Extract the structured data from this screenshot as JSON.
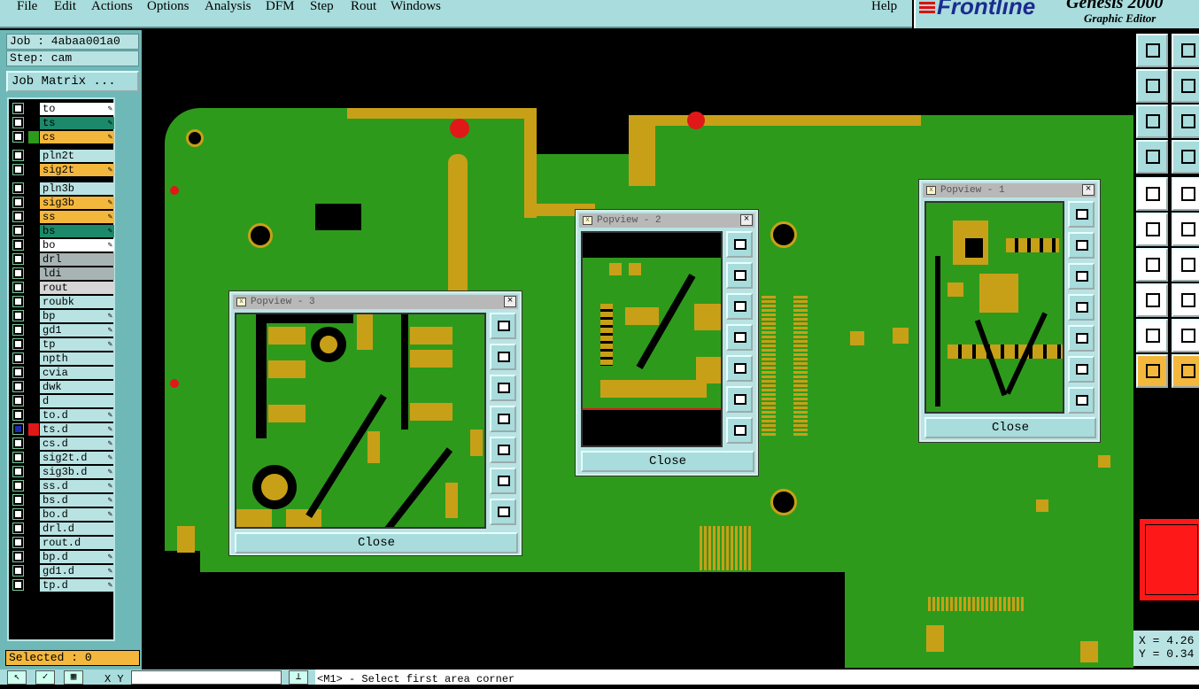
{
  "menu": {
    "items": [
      "File",
      "Edit",
      "Actions",
      "Options",
      "Analysis",
      "DFM",
      "Step",
      "Rout",
      "Windows"
    ],
    "help": "Help"
  },
  "brand": {
    "logo": "Frontline",
    "product": "Genesis 2000",
    "subtitle": "Graphic Editor"
  },
  "job": {
    "job_line": "Job : 4abaa001a0",
    "step_line": "Step: cam",
    "matrix_button": "Job Matrix ..."
  },
  "layers": [
    {
      "name": "to",
      "color": "#ffffff",
      "editable": true
    },
    {
      "name": "ts",
      "color": "#1c8a6a",
      "editable": true
    },
    {
      "name": "cs",
      "color": "#f4b73d",
      "editable": true
    },
    {
      "name": "pln2t",
      "color": "#b9e3e3",
      "editable": false
    },
    {
      "name": "sig2t",
      "color": "#f4b73d",
      "editable": true
    },
    {
      "name": "pln3b",
      "color": "#b9e3e3",
      "editable": false
    },
    {
      "name": "sig3b",
      "color": "#f4b73d",
      "editable": true
    },
    {
      "name": "ss",
      "color": "#f4b73d",
      "editable": true
    },
    {
      "name": "bs",
      "color": "#1c8a6a",
      "editable": true
    },
    {
      "name": "bo",
      "color": "#ffffff",
      "editable": true
    },
    {
      "name": "drl",
      "color": "#a8b4b4",
      "editable": false
    },
    {
      "name": "ldi",
      "color": "#a8b4b4",
      "editable": false
    },
    {
      "name": "rout",
      "color": "#d6d6d6",
      "editable": false
    },
    {
      "name": "roubk",
      "color": "#b9e3e3",
      "editable": false
    },
    {
      "name": "bp",
      "color": "#b9e3e3",
      "editable": true
    },
    {
      "name": "gd1",
      "color": "#b9e3e3",
      "editable": true
    },
    {
      "name": "tp",
      "color": "#b9e3e3",
      "editable": true
    },
    {
      "name": "npth",
      "color": "#b9e3e3",
      "editable": false
    },
    {
      "name": "cvia",
      "color": "#b9e3e3",
      "editable": false
    },
    {
      "name": "dwk",
      "color": "#b9e3e3",
      "editable": false
    },
    {
      "name": "d",
      "color": "#b9e3e3",
      "editable": false
    },
    {
      "name": "to.d",
      "color": "#b9e3e3",
      "editable": true
    },
    {
      "name": "ts.d",
      "color": "#b9e3e3",
      "editable": true,
      "active": true
    },
    {
      "name": "cs.d",
      "color": "#b9e3e3",
      "editable": true
    },
    {
      "name": "sig2t.d",
      "color": "#b9e3e3",
      "editable": true
    },
    {
      "name": "sig3b.d",
      "color": "#b9e3e3",
      "editable": true
    },
    {
      "name": "ss.d",
      "color": "#b9e3e3",
      "editable": true
    },
    {
      "name": "bs.d",
      "color": "#b9e3e3",
      "editable": true
    },
    {
      "name": "bo.d",
      "color": "#b9e3e3",
      "editable": true
    },
    {
      "name": "drl.d",
      "color": "#b9e3e3",
      "editable": false
    },
    {
      "name": "rout.d",
      "color": "#b9e3e3",
      "editable": false
    },
    {
      "name": "bp.d",
      "color": "#b9e3e3",
      "editable": true
    },
    {
      "name": "gd1.d",
      "color": "#b9e3e3",
      "editable": true
    },
    {
      "name": "tp.d",
      "color": "#b9e3e3",
      "editable": true
    }
  ],
  "status": {
    "selected": "Selected : 0",
    "xy_label": "X Y :",
    "message": "<M1> - Select first area corner"
  },
  "popviews": [
    {
      "title": "Popview - 3",
      "close": "Close"
    },
    {
      "title": "Popview - 2",
      "close": "Close"
    },
    {
      "title": "Popview - 1",
      "close": "Close"
    }
  ],
  "coords": {
    "x": "X = 4.26",
    "y": "Y = 0.34"
  },
  "colors": {
    "board": "#2e9a1c",
    "copper": "#c8a018",
    "panel": "#a9dcdc",
    "accent": "#f4b73d"
  }
}
